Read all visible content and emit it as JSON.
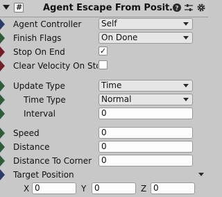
{
  "header": {
    "title": "Agent Escape From Posit…",
    "enabled_glyph": "#",
    "icons": [
      "help-icon",
      "presets-icon",
      "settings-icon"
    ]
  },
  "fields": {
    "agent_controller": {
      "label": "Agent Controller",
      "value": "Self"
    },
    "finish_flags": {
      "label": "Finish Flags",
      "value": "On Done"
    },
    "stop_on_end": {
      "label": "Stop On End",
      "checked": true,
      "check_glyph": "✓"
    },
    "clear_velocity": {
      "label": "Clear Velocity On Sto",
      "checked": false
    },
    "update_type": {
      "label": "Update Type",
      "value": "Time"
    },
    "time_type": {
      "label": "Time Type",
      "value": "Normal"
    },
    "interval": {
      "label": "Interval",
      "value": "0"
    },
    "speed": {
      "label": "Speed",
      "value": "0"
    },
    "distance": {
      "label": "Distance",
      "value": "0"
    },
    "distance_to_corner": {
      "label": "Distance To Corner",
      "value": "0"
    },
    "target_position": {
      "label": "Target Position",
      "x_label": "X",
      "x": "0",
      "y_label": "Y",
      "y": "0",
      "z_label": "Z",
      "z": "0"
    }
  },
  "colors": {
    "background": "#c8c8c8",
    "field_bg": "#fdfdfd",
    "swatch_navy": "#2b3a66",
    "swatch_green": "#2f5a3c",
    "swatch_maroon": "#6e1f2a"
  }
}
